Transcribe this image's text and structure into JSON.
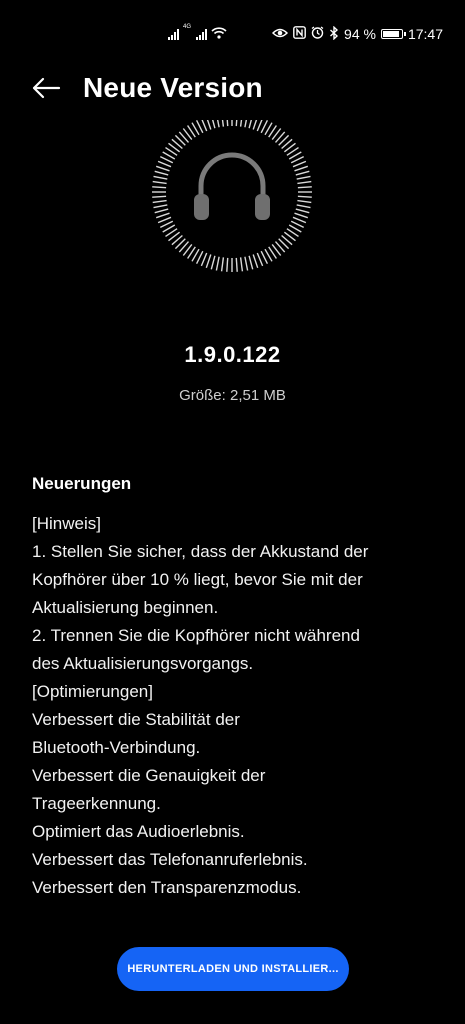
{
  "status_bar": {
    "network_tag": "4G",
    "battery_text": "94 %",
    "time": "17:47",
    "icons": [
      "signal-icon",
      "signal-icon",
      "wifi-icon",
      "eye-icon",
      "nfc-icon",
      "alarm-icon",
      "bluetooth-icon",
      "battery-icon"
    ]
  },
  "header": {
    "title": "Neue Version",
    "back_icon": "arrow-left-icon"
  },
  "hero": {
    "icon": "headphones-icon"
  },
  "update": {
    "version": "1.9.0.122",
    "size": "Größe: 2,51 MB"
  },
  "notes": {
    "heading": "Neuerungen",
    "lines": [
      "[Hinweis]",
      "1. Stellen Sie sicher, dass der Akkustand der",
      "Kopfhörer über 10 % liegt, bevor Sie mit der",
      "Aktualisierung beginnen.",
      "2. Trennen Sie die Kopfhörer nicht während",
      "des Aktualisierungsvorgangs.",
      "[Optimierungen]",
      "Verbessert die Stabilität der",
      "Bluetooth-Verbindung.",
      "Verbessert die Genauigkeit der",
      "Trageerkennung.",
      "Optimiert das Audioerlebnis.",
      "Verbessert das Telefonanruferlebnis.",
      "Verbessert den Transparenzmodus."
    ]
  },
  "action": {
    "button_label": "HERUNTERLADEN UND INSTALLIER..."
  },
  "colors": {
    "background": "#000000",
    "accent": "#1564f5",
    "text": "#ffffff",
    "secondary_text": "#cfcfcf"
  }
}
